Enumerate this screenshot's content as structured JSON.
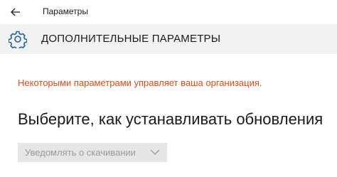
{
  "window": {
    "title": "Параметры",
    "back_icon": "back-arrow-icon"
  },
  "header": {
    "icon": "gear-icon",
    "title": "ДОПОЛНИТЕЛЬНЫЕ ПАРАМЕТРЫ"
  },
  "notice": {
    "text": "Некоторыми параметрами управляет ваша организация.",
    "color": "#e64a0c"
  },
  "section": {
    "heading": "Выберите, как устанавливать обновления"
  },
  "update_mode": {
    "selected": "Уведомлять о скачивании",
    "disabled": true
  }
}
